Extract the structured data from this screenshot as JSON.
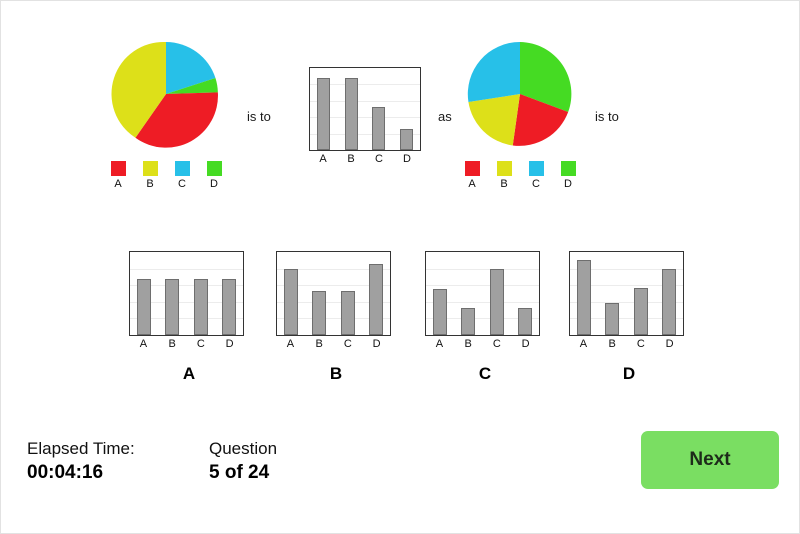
{
  "question": {
    "connector_1": "is to",
    "connector_2": "as",
    "connector_3": "is to"
  },
  "palette": {
    "red": "#ee1c25",
    "yellow": "#dde019",
    "cyan": "#27c0e8",
    "green": "#45db23",
    "bar_fill": "#a0a0a0",
    "bar_stroke": "#6e6e6e",
    "chart_border": "#333333",
    "gridline": "#ececec",
    "next_button": "#7ade62"
  },
  "legend": {
    "entries": [
      {
        "label": "A",
        "color": "#ee1c25"
      },
      {
        "label": "B",
        "color": "#dde019"
      },
      {
        "label": "C",
        "color": "#27c0e8"
      },
      {
        "label": "D",
        "color": "#45db23"
      }
    ]
  },
  "chart_data": [
    {
      "id": "term-1-pie",
      "type": "pie",
      "title": "",
      "categories": [
        "C",
        "D",
        "A",
        "B"
      ],
      "values": [
        20,
        10,
        35,
        35
      ],
      "colors": [
        "#27c0e8",
        "#45db23",
        "#ee1c25",
        "#dde019"
      ],
      "legend": [
        "A",
        "B",
        "C",
        "D"
      ],
      "legend_position": "bottom",
      "start_angle": 0
    },
    {
      "id": "term-2-bar",
      "type": "bar",
      "title": "",
      "categories": [
        "A",
        "B",
        "C",
        "D"
      ],
      "values": [
        88,
        88,
        52,
        26
      ],
      "ylim": [
        0,
        100
      ],
      "xlabel": "",
      "ylabel": "",
      "grid": true,
      "gridlines": 4
    },
    {
      "id": "term-3-pie",
      "type": "pie",
      "title": "",
      "categories": [
        "D",
        "A",
        "B",
        "C"
      ],
      "values": [
        30,
        27,
        22,
        21
      ],
      "colors": [
        "#45db23",
        "#ee1c25",
        "#dde019",
        "#27c0e8"
      ],
      "legend": [
        "A",
        "B",
        "C",
        "D"
      ],
      "legend_position": "bottom",
      "start_angle": 0
    }
  ],
  "options": [
    {
      "letter": "A",
      "chart": {
        "type": "bar",
        "categories": [
          "A",
          "B",
          "C",
          "D"
        ],
        "values": [
          68,
          68,
          68,
          68
        ],
        "ylim": [
          0,
          100
        ],
        "grid": true,
        "gridlines": 4
      }
    },
    {
      "letter": "B",
      "chart": {
        "type": "bar",
        "categories": [
          "A",
          "B",
          "C",
          "D"
        ],
        "values": [
          80,
          53,
          53,
          85
        ],
        "ylim": [
          0,
          100
        ],
        "grid": true,
        "gridlines": 4
      }
    },
    {
      "letter": "C",
      "chart": {
        "type": "bar",
        "categories": [
          "A",
          "B",
          "C",
          "D"
        ],
        "values": [
          55,
          33,
          80,
          33
        ],
        "ylim": [
          0,
          100
        ],
        "grid": true,
        "gridlines": 4
      }
    },
    {
      "letter": "D",
      "chart": {
        "type": "bar",
        "categories": [
          "A",
          "B",
          "C",
          "D"
        ],
        "values": [
          90,
          38,
          57,
          80
        ],
        "ylim": [
          0,
          100
        ],
        "grid": true,
        "gridlines": 4
      }
    }
  ],
  "footer": {
    "elapsed_label": "Elapsed Time:",
    "elapsed_value": "00:04:16",
    "question_label": "Question",
    "question_value": "5 of 24",
    "next_label": "Next"
  }
}
